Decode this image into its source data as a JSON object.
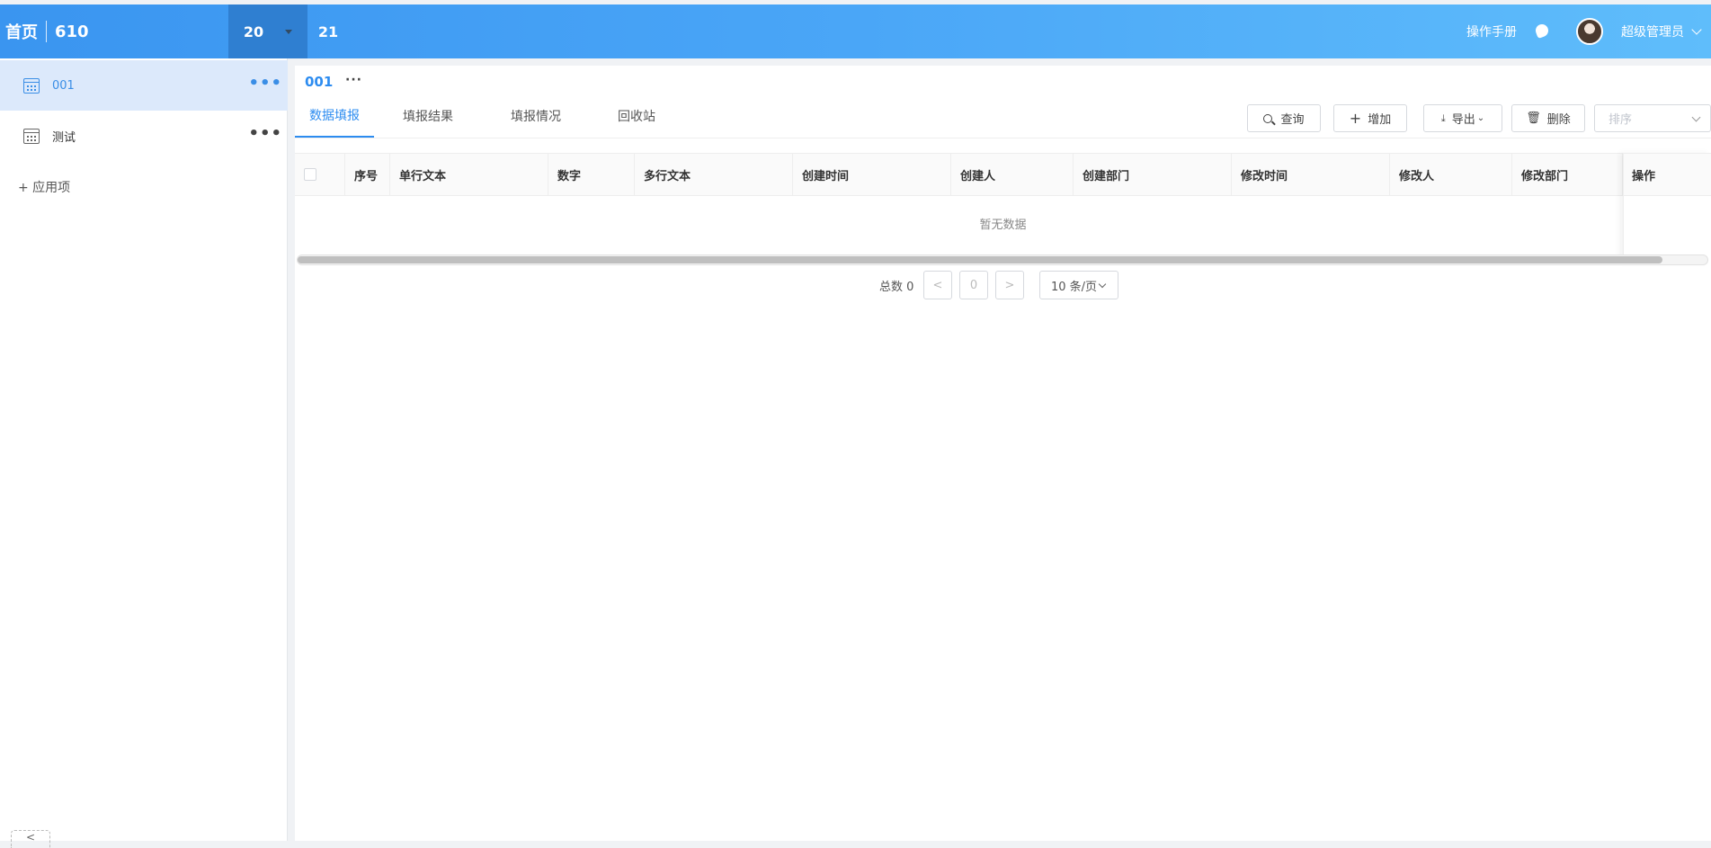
{
  "header": {
    "home": "首页",
    "app_id": "610",
    "nav_tabs": [
      {
        "label": "20",
        "active": true
      },
      {
        "label": "21",
        "active": false
      }
    ],
    "manual": "操作手册",
    "user": "超级管理员"
  },
  "sidebar": {
    "items": [
      {
        "label": "001",
        "active": true
      },
      {
        "label": "测试",
        "active": false
      }
    ],
    "add_app": "+ 应用项",
    "collapse": "<"
  },
  "main": {
    "title": "001",
    "more": "···",
    "tabs": [
      {
        "label": "数据填报",
        "active": true
      },
      {
        "label": "填报结果",
        "active": false
      },
      {
        "label": "填报情况",
        "active": false
      },
      {
        "label": "回收站",
        "active": false
      }
    ],
    "toolbar": {
      "query": "查询",
      "add": "增加",
      "export": "导出",
      "delete": "删除",
      "sort_placeholder": "排序"
    },
    "table": {
      "columns": [
        "序号",
        "单行文本",
        "数字",
        "多行文本",
        "创建时间",
        "创建人",
        "创建部门",
        "修改时间",
        "修改人",
        "修改部门",
        "操作"
      ],
      "empty_text": "暂无数据"
    },
    "pagination": {
      "total": "总数 0",
      "prev": "<",
      "page": "0",
      "next": ">",
      "page_size": "10 条/页"
    }
  }
}
